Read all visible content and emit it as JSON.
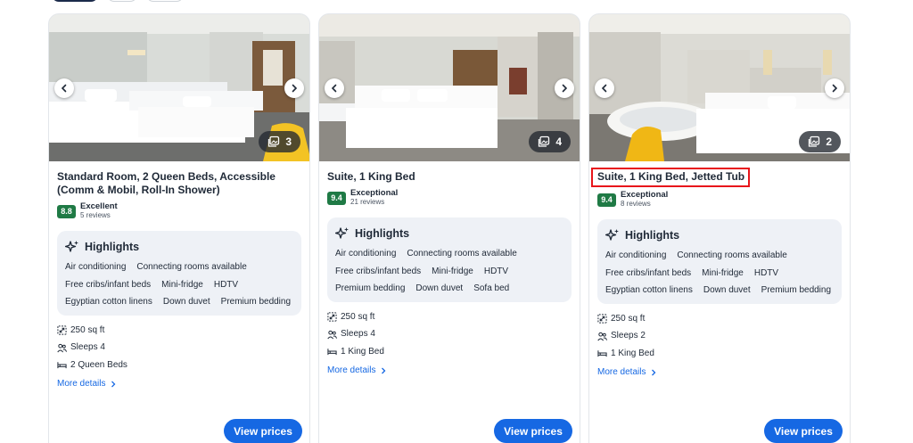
{
  "cards": [
    {
      "photo_count": "3",
      "title": "Standard Room, 2 Queen Beds, Accessible (Comm & Mobil, Roll-In Shower)",
      "score": "8.8",
      "rating_label": "Excellent",
      "reviews": "5 reviews",
      "highlights_title": "Highlights",
      "features": [
        "Air conditioning",
        "Connecting rooms available",
        "Free cribs/infant beds",
        "Mini-fridge",
        "HDTV",
        "Egyptian cotton linens",
        "Down duvet",
        "Premium bedding"
      ],
      "area": "250 sq ft",
      "sleeps": "Sleeps 4",
      "beds": "2 Queen Beds",
      "more_details": "More details",
      "view_prices": "View prices"
    },
    {
      "photo_count": "4",
      "title": "Suite, 1 King Bed",
      "score": "9.4",
      "rating_label": "Exceptional",
      "reviews": "21 reviews",
      "highlights_title": "Highlights",
      "features": [
        "Air conditioning",
        "Connecting rooms available",
        "Free cribs/infant beds",
        "Mini-fridge",
        "HDTV",
        "Premium bedding",
        "Down duvet",
        "Sofa bed"
      ],
      "area": "250 sq ft",
      "sleeps": "Sleeps 4",
      "beds": "1 King Bed",
      "more_details": "More details",
      "view_prices": "View prices"
    },
    {
      "photo_count": "2",
      "title": "Suite, 1 King Bed, Jetted Tub",
      "score": "9.4",
      "rating_label": "Exceptional",
      "reviews": "8 reviews",
      "highlights_title": "Highlights",
      "features": [
        "Air conditioning",
        "Connecting rooms available",
        "Free cribs/infant beds",
        "Mini-fridge",
        "HDTV",
        "Egyptian cotton linens",
        "Down duvet",
        "Premium bedding"
      ],
      "area": "250 sq ft",
      "sleeps": "Sleeps 2",
      "beds": "1 King Bed",
      "more_details": "More details",
      "view_prices": "View prices"
    }
  ],
  "colors": {
    "accent_blue": "#1668e3",
    "score_green": "#1f7a45",
    "highlight_red": "#e8151b",
    "highlights_bg": "#eef1f6"
  },
  "icons": {
    "prev": "chevron-left-icon",
    "next": "chevron-right-icon",
    "gallery": "gallery-icon",
    "highlights": "sparkle-icon",
    "area": "expand-arrows-icon",
    "sleeps": "people-icon",
    "beds": "bed-icon",
    "more": "chevron-right-icon"
  }
}
